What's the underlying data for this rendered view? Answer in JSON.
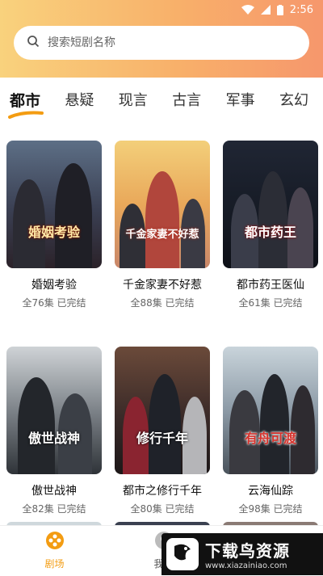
{
  "status": {
    "time": "2:56"
  },
  "search": {
    "placeholder": "搜索短剧名称"
  },
  "tabs": [
    "都市",
    "悬疑",
    "现言",
    "古言",
    "军事",
    "玄幻"
  ],
  "dramas": [
    {
      "title": "婚姻考验",
      "episodes": "全76集",
      "status": "已完结",
      "poster_text": "婚姻考验"
    },
    {
      "title": "千金家妻不好惹",
      "episodes": "全88集",
      "status": "已完结",
      "poster_text": "千金家妻不好惹"
    },
    {
      "title": "都市药王医仙",
      "episodes": "全61集",
      "status": "已完结",
      "poster_text": "都市药王"
    },
    {
      "title": "傲世战神",
      "episodes": "全82集",
      "status": "已完结",
      "poster_text": "傲世战神"
    },
    {
      "title": "都市之修行千年",
      "episodes": "全80集",
      "status": "已完结",
      "poster_text": "修行千年"
    },
    {
      "title": "云海仙踪",
      "episodes": "全98集",
      "status": "已完结",
      "poster_text": "有舟可渡"
    }
  ],
  "nav": {
    "home_label": "剧场",
    "mine_label": "我的"
  },
  "watermark": {
    "title": "下载鸟资源",
    "url": "www.xiazainiao.com"
  },
  "colors": {
    "accent": "#f39c12",
    "header_start": "#f9d27d",
    "header_end": "#f6976c"
  }
}
